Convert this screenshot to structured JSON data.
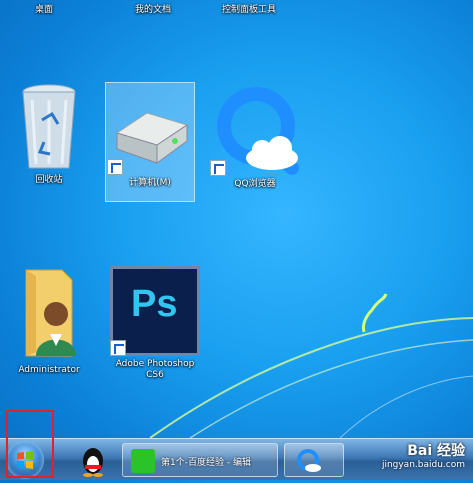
{
  "desktop": {
    "top_labels": [
      "桌面",
      "我的文档",
      "控制面板工具"
    ],
    "icons": [
      {
        "label": "回收站",
        "icon": "recycle-bin-icon"
      },
      {
        "label": "计算机(M)",
        "icon": "hard-drive-icon",
        "shortcut": true,
        "selected": true
      },
      {
        "label": "QQ浏览器",
        "icon": "qq-browser-icon",
        "shortcut": true
      },
      {
        "label": "Administrator",
        "icon": "user-folder-icon"
      },
      {
        "label": "Adobe Photoshop CS6",
        "icon": "photoshop-icon",
        "shortcut": true,
        "badge_text": "Ps"
      }
    ]
  },
  "taskbar": {
    "start_button": "start-orb",
    "items": [
      {
        "label": "",
        "icon": "qq-penguin-icon"
      },
      {
        "label": "第1个-百度经验 - 编辑",
        "icon": "green-app-icon"
      },
      {
        "label": "",
        "icon": "qq-browser-icon"
      }
    ]
  },
  "watermark": {
    "main": "Bai 经验",
    "sub": "jingyan.baidu.com"
  },
  "colors": {
    "highlight": "#e0222a",
    "ps_blue": "#31c5f0",
    "ps_bg": "#0b1f4d"
  }
}
